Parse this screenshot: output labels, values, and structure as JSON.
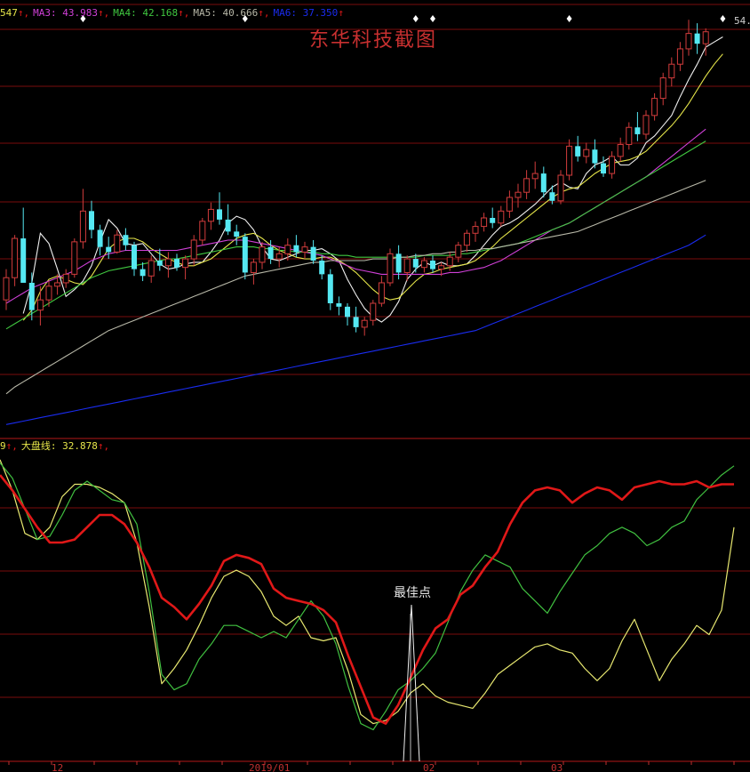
{
  "colors": {
    "background": "#000000",
    "grid": "#7a0c0c",
    "candle_up": "#d23c3c",
    "candle_down": "#55e8f2",
    "ma_white": "#f0f0f0",
    "ma_yellow": "#e6e64a",
    "ma_magenta": "#d040d8",
    "ma_green": "#40c840",
    "ma_gray": "#b8b8a8",
    "ma_blue": "#1a2cf0",
    "ind_red": "#e01818",
    "ind_green": "#40c040",
    "ind_yellow": "#e8e870",
    "marker": "#ffffff",
    "watermark": "#c83030"
  },
  "price_legend": [
    {
      "text": "547",
      "color": "#e6e64a"
    },
    {
      "text": "↑,",
      "color": "#e01818"
    },
    {
      "text": "MA3: 43.983",
      "color": "#d040d8"
    },
    {
      "text": "↑,",
      "color": "#e01818"
    },
    {
      "text": "MA4: 42.168",
      "color": "#40c840"
    },
    {
      "text": "↑,",
      "color": "#e01818"
    },
    {
      "text": "MA5: 40.666",
      "color": "#b8b8a8"
    },
    {
      "text": "↑,",
      "color": "#e01818"
    },
    {
      "text": "MA6: 37.350",
      "color": "#1a2cf0"
    },
    {
      "text": "↑",
      "color": "#e01818"
    }
  ],
  "indicator_legend": [
    {
      "text": "9",
      "color": "#e6e64a"
    },
    {
      "text": "↑,",
      "color": "#e01818"
    },
    {
      "text": "大盘线: 32.878",
      "color": "#e6e64a"
    },
    {
      "text": "↑,",
      "color": "#e01818"
    }
  ],
  "watermark": "东华科技截图",
  "annotation": "最佳点",
  "last_price_label": "54.",
  "x_labels": [
    "12",
    "2019/01",
    "02",
    "03"
  ],
  "chart_data": {
    "type": "candlestick",
    "price_ylim": [
      31.5,
      56.5
    ],
    "candles": [
      [
        39.2,
        41.0,
        38.6,
        40.5
      ],
      [
        40.5,
        43.0,
        40.0,
        42.8
      ],
      [
        42.8,
        44.6,
        42.3,
        40.2
      ],
      [
        40.2,
        40.8,
        38.0,
        38.6
      ],
      [
        38.6,
        40.0,
        37.7,
        39.2
      ],
      [
        39.2,
        40.3,
        38.8,
        40.0
      ],
      [
        40.0,
        40.7,
        39.5,
        40.2
      ],
      [
        40.2,
        41.0,
        39.9,
        40.7
      ],
      [
        40.7,
        42.8,
        40.5,
        42.6
      ],
      [
        42.6,
        45.7,
        42.2,
        44.4
      ],
      [
        44.4,
        45.0,
        42.8,
        43.3
      ],
      [
        43.3,
        43.6,
        41.8,
        42.3
      ],
      [
        42.3,
        42.9,
        41.6,
        42.0
      ],
      [
        42.0,
        43.3,
        41.9,
        43.0
      ],
      [
        43.0,
        43.4,
        42.1,
        42.4
      ],
      [
        42.4,
        42.6,
        40.6,
        41.0
      ],
      [
        41.0,
        41.4,
        40.3,
        40.6
      ],
      [
        40.6,
        41.8,
        40.2,
        41.5
      ],
      [
        41.5,
        42.2,
        40.9,
        41.2
      ],
      [
        41.2,
        42.0,
        40.5,
        41.6
      ],
      [
        41.6,
        41.9,
        40.9,
        41.1
      ],
      [
        41.1,
        41.8,
        40.4,
        41.6
      ],
      [
        41.6,
        43.0,
        41.2,
        42.7
      ],
      [
        42.7,
        44.0,
        42.4,
        43.8
      ],
      [
        43.8,
        44.9,
        43.3,
        44.5
      ],
      [
        44.5,
        45.5,
        43.6,
        43.9
      ],
      [
        43.9,
        44.8,
        43.0,
        43.2
      ],
      [
        43.2,
        43.6,
        42.4,
        42.9
      ],
      [
        42.9,
        43.1,
        40.4,
        40.8
      ],
      [
        40.8,
        41.6,
        40.1,
        41.4
      ],
      [
        41.4,
        42.6,
        41.0,
        42.3
      ],
      [
        42.3,
        42.7,
        41.3,
        41.6
      ],
      [
        41.6,
        42.3,
        41.1,
        41.9
      ],
      [
        41.9,
        42.8,
        41.5,
        42.4
      ],
      [
        42.4,
        43.0,
        41.7,
        42.0
      ],
      [
        42.0,
        42.6,
        41.6,
        42.3
      ],
      [
        42.3,
        42.7,
        41.3,
        41.5
      ],
      [
        41.5,
        41.8,
        40.4,
        40.7
      ],
      [
        40.7,
        41.0,
        38.6,
        39.0
      ],
      [
        39.0,
        39.4,
        38.3,
        38.8
      ],
      [
        38.8,
        39.0,
        37.7,
        38.2
      ],
      [
        38.2,
        38.8,
        37.3,
        37.6
      ],
      [
        37.6,
        38.2,
        37.1,
        38.0
      ],
      [
        38.0,
        39.2,
        37.7,
        39.0
      ],
      [
        39.0,
        40.6,
        38.8,
        40.2
      ],
      [
        40.2,
        42.2,
        40.0,
        41.9
      ],
      [
        41.9,
        42.4,
        40.4,
        40.8
      ],
      [
        40.8,
        41.8,
        40.3,
        41.6
      ],
      [
        41.6,
        41.9,
        40.8,
        41.1
      ],
      [
        41.1,
        41.7,
        40.8,
        41.5
      ],
      [
        41.5,
        41.8,
        40.8,
        41.0
      ],
      [
        41.0,
        41.4,
        40.6,
        41.2
      ],
      [
        41.2,
        42.0,
        40.9,
        41.7
      ],
      [
        41.7,
        42.6,
        41.4,
        42.4
      ],
      [
        42.4,
        43.3,
        42.0,
        43.1
      ],
      [
        43.1,
        43.8,
        42.6,
        43.5
      ],
      [
        43.5,
        44.3,
        43.2,
        44.0
      ],
      [
        44.0,
        44.6,
        43.4,
        43.7
      ],
      [
        43.7,
        44.7,
        43.5,
        44.4
      ],
      [
        44.4,
        45.6,
        44.0,
        45.2
      ],
      [
        45.2,
        46.0,
        44.6,
        45.5
      ],
      [
        45.5,
        46.8,
        45.1,
        46.3
      ],
      [
        46.3,
        47.3,
        45.7,
        46.6
      ],
      [
        46.6,
        47.0,
        45.2,
        45.5
      ],
      [
        45.5,
        45.9,
        44.8,
        45.0
      ],
      [
        45.0,
        46.8,
        44.8,
        46.5
      ],
      [
        46.5,
        48.6,
        46.2,
        48.2
      ],
      [
        48.2,
        48.8,
        47.3,
        47.6
      ],
      [
        47.6,
        48.4,
        47.2,
        48.0
      ],
      [
        48.0,
        48.6,
        46.9,
        47.2
      ],
      [
        47.2,
        47.6,
        46.4,
        46.6
      ],
      [
        46.6,
        47.9,
        46.3,
        47.6
      ],
      [
        47.6,
        48.7,
        47.3,
        48.3
      ],
      [
        48.3,
        49.6,
        48.0,
        49.3
      ],
      [
        49.3,
        50.2,
        48.5,
        48.9
      ],
      [
        48.9,
        50.3,
        48.6,
        50.0
      ],
      [
        50.0,
        51.3,
        49.7,
        51.0
      ],
      [
        51.0,
        52.5,
        50.6,
        52.2
      ],
      [
        52.2,
        53.4,
        51.7,
        53.0
      ],
      [
        53.0,
        54.3,
        52.6,
        53.9
      ],
      [
        53.9,
        55.6,
        53.5,
        54.8
      ],
      [
        54.8,
        55.4,
        53.6,
        54.2
      ],
      [
        54.2,
        55.1,
        53.5,
        54.9
      ]
    ],
    "ma_lines": [
      {
        "name": "MA1",
        "color": "#f0f0f0",
        "start": 2,
        "values": [
          38.4,
          40.2,
          43.1,
          42.5,
          41.0,
          39.4,
          39.8,
          40.3,
          41.2,
          42.6,
          43.9,
          43.4,
          42.5,
          42.4,
          42.5,
          41.9,
          41.3,
          41.0,
          41.1,
          41.3,
          41.4,
          41.4,
          42.0,
          42.7,
          43.7,
          44.1,
          43.9,
          43.3,
          42.3,
          41.6,
          41.5,
          41.7,
          41.9,
          42.1,
          42.1,
          42.2,
          41.9,
          41.5,
          40.4,
          39.5,
          38.7,
          38.2,
          37.9,
          38.3,
          39.1,
          40.4,
          41.0,
          41.4,
          41.2,
          41.4,
          41.2,
          41.2,
          41.3,
          41.8,
          42.4,
          43.0,
          43.5,
          43.7,
          44.0,
          44.4,
          44.8,
          45.3,
          45.8,
          46.1,
          45.8,
          45.7,
          46.6,
          47.1,
          47.3,
          47.6,
          47.1,
          47.1,
          47.5,
          48.4,
          48.8,
          49.4,
          50.0,
          51.1,
          52.1,
          53.0,
          54.0,
          54.3,
          54.6
        ]
      },
      {
        "name": "MA2",
        "color": "#e6e64a",
        "start": 2,
        "values": [
          38.0,
          38.6,
          39.7,
          40.4,
          40.6,
          40.4,
          40.2,
          40.1,
          40.6,
          41.4,
          42.2,
          42.6,
          42.8,
          42.8,
          42.6,
          42.2,
          41.9,
          41.6,
          41.4,
          41.2,
          41.2,
          41.4,
          41.6,
          42.0,
          42.4,
          42.8,
          43.0,
          43.1,
          42.8,
          42.4,
          42.1,
          41.9,
          41.7,
          41.6,
          41.6,
          41.7,
          41.7,
          41.5,
          41.2,
          40.8,
          40.3,
          39.8,
          39.4,
          39.2,
          39.3,
          39.8,
          40.3,
          40.7,
          40.8,
          41.0,
          41.1,
          41.2,
          41.3,
          41.5,
          41.9,
          42.3,
          42.8,
          43.2,
          43.6,
          44.0,
          44.4,
          44.8,
          45.2,
          45.5,
          45.7,
          45.8,
          46.2,
          46.6,
          46.9,
          47.2,
          47.3,
          47.4,
          47.6,
          47.9,
          48.4,
          48.9,
          49.4,
          50.0,
          50.7,
          51.5,
          52.3,
          53.0,
          53.6
        ]
      },
      {
        "name": "MA3",
        "color": "#d040d8",
        "start": 0,
        "values": [
          39.0,
          39.3,
          39.6,
          39.9,
          40.1,
          40.3,
          40.5,
          40.7,
          40.9,
          41.2,
          41.5,
          41.7,
          41.9,
          42.0,
          42.1,
          42.1,
          42.1,
          42.1,
          42.1,
          42.1,
          42.1,
          42.2,
          42.3,
          42.4,
          42.5,
          42.6,
          42.7,
          42.7,
          42.7,
          42.6,
          42.5,
          42.4,
          42.3,
          42.2,
          42.1,
          42.0,
          41.9,
          41.8,
          41.6,
          41.4,
          41.2,
          41.0,
          40.9,
          40.8,
          40.7,
          40.7,
          40.7,
          40.7,
          40.7,
          40.7,
          40.7,
          40.7,
          40.8,
          40.8,
          40.9,
          41.0,
          41.1,
          41.3,
          41.5,
          41.8,
          42.1,
          42.4,
          42.7,
          43.0,
          43.3,
          43.5,
          43.7,
          44.0,
          44.3,
          44.6,
          44.9,
          45.2,
          45.5,
          45.8,
          46.1,
          46.4,
          46.8,
          47.2,
          47.6,
          48.0,
          48.4,
          48.8,
          49.2
        ]
      },
      {
        "name": "MA4",
        "color": "#40c840",
        "start": 0,
        "values": [
          37.5,
          37.8,
          38.1,
          38.4,
          38.7,
          39.0,
          39.3,
          39.6,
          39.9,
          40.2,
          40.5,
          40.7,
          40.9,
          41.0,
          41.1,
          41.2,
          41.3,
          41.4,
          41.5,
          41.6,
          41.6,
          41.7,
          41.8,
          41.9,
          42.0,
          42.1,
          42.2,
          42.3,
          42.3,
          42.3,
          42.2,
          42.2,
          42.1,
          42.1,
          42.0,
          42.0,
          42.0,
          41.9,
          41.9,
          41.8,
          41.8,
          41.7,
          41.7,
          41.7,
          41.7,
          41.7,
          41.7,
          41.7,
          41.7,
          41.8,
          41.8,
          41.8,
          41.8,
          41.9,
          41.9,
          42.0,
          42.1,
          42.2,
          42.3,
          42.4,
          42.5,
          42.7,
          42.9,
          43.1,
          43.3,
          43.5,
          43.7,
          44.0,
          44.3,
          44.6,
          44.9,
          45.2,
          45.5,
          45.8,
          46.1,
          46.4,
          46.7,
          47.0,
          47.3,
          47.6,
          47.9,
          48.2,
          48.5
        ]
      },
      {
        "name": "MA5",
        "color": "#b8b8a8",
        "start": 0,
        "values": [
          33.7,
          34.1,
          34.4,
          34.7,
          35.0,
          35.3,
          35.6,
          35.9,
          36.2,
          36.5,
          36.8,
          37.1,
          37.4,
          37.6,
          37.8,
          38.0,
          38.2,
          38.4,
          38.6,
          38.8,
          39.0,
          39.2,
          39.4,
          39.6,
          39.8,
          40.0,
          40.2,
          40.4,
          40.6,
          40.7,
          40.8,
          40.9,
          41.0,
          41.1,
          41.2,
          41.3,
          41.4,
          41.4,
          41.5,
          41.5,
          41.5,
          41.5,
          41.5,
          41.6,
          41.6,
          41.6,
          41.7,
          41.7,
          41.8,
          41.8,
          41.9,
          41.9,
          42.0,
          42.0,
          42.1,
          42.1,
          42.2,
          42.2,
          42.3,
          42.4,
          42.5,
          42.6,
          42.7,
          42.8,
          42.9,
          43.0,
          43.1,
          43.2,
          43.4,
          43.6,
          43.8,
          44.0,
          44.2,
          44.4,
          44.6,
          44.8,
          45.0,
          45.2,
          45.4,
          45.6,
          45.8,
          46.0,
          46.2
        ]
      },
      {
        "name": "MA6",
        "color": "#1a2cf0",
        "start": 0,
        "values": [
          31.9,
          32.0,
          32.1,
          32.2,
          32.3,
          32.4,
          32.5,
          32.6,
          32.7,
          32.8,
          32.9,
          33.0,
          33.1,
          33.2,
          33.3,
          33.4,
          33.5,
          33.6,
          33.7,
          33.8,
          33.9,
          34.0,
          34.1,
          34.2,
          34.3,
          34.4,
          34.5,
          34.6,
          34.7,
          34.8,
          34.9,
          35.0,
          35.1,
          35.2,
          35.3,
          35.4,
          35.5,
          35.6,
          35.7,
          35.8,
          35.9,
          36.0,
          36.1,
          36.2,
          36.3,
          36.4,
          36.5,
          36.6,
          36.7,
          36.8,
          36.9,
          37.0,
          37.1,
          37.2,
          37.3,
          37.4,
          37.6,
          37.8,
          38.0,
          38.2,
          38.4,
          38.6,
          38.8,
          39.0,
          39.2,
          39.4,
          39.6,
          39.8,
          40.0,
          40.2,
          40.4,
          40.6,
          40.8,
          41.0,
          41.2,
          41.4,
          41.6,
          41.8,
          42.0,
          42.2,
          42.4,
          42.7,
          43.0
        ]
      }
    ],
    "markers": [
      9,
      28,
      48,
      50,
      66,
      84
    ],
    "indicator": {
      "ylim": [
        0,
        100
      ],
      "series": [
        {
          "name": "red",
          "color": "#e01818",
          "width": 2.6,
          "values": [
            93,
            88,
            82,
            76,
            71,
            71,
            72,
            76,
            80,
            80,
            77,
            71,
            63,
            53,
            50,
            46,
            51,
            57,
            65,
            67,
            66,
            64,
            56,
            53,
            52,
            51,
            49,
            45,
            34,
            24,
            14,
            12,
            18,
            27,
            36,
            43,
            46,
            54,
            57,
            63,
            68,
            77,
            84,
            88,
            89,
            88,
            84,
            87,
            89,
            88,
            85,
            89,
            90,
            91,
            90,
            90,
            91,
            89,
            90,
            90
          ]
        },
        {
          "name": "green",
          "color": "#40c040",
          "width": 1.2,
          "values": [
            97,
            92,
            82,
            72,
            73,
            80,
            88,
            91,
            88,
            85,
            84,
            77,
            55,
            28,
            23,
            25,
            33,
            38,
            44,
            44,
            42,
            40,
            42,
            40,
            46,
            52,
            47,
            38,
            24,
            12,
            10,
            16,
            23,
            26,
            30,
            35,
            45,
            55,
            62,
            67,
            65,
            63,
            56,
            52,
            48,
            55,
            61,
            67,
            70,
            74,
            76,
            74,
            70,
            72,
            76,
            78,
            85,
            89,
            93,
            96
          ]
        },
        {
          "name": "yellow",
          "color": "#e8e870",
          "width": 1.2,
          "values": [
            98,
            88,
            74,
            72,
            76,
            86,
            90,
            90,
            89,
            87,
            84,
            71,
            50,
            25,
            30,
            36,
            44,
            53,
            60,
            62,
            60,
            55,
            47,
            44,
            47,
            40,
            39,
            40,
            29,
            15,
            12,
            13,
            16,
            22,
            25,
            21,
            19,
            18,
            17,
            22,
            28,
            31,
            34,
            37,
            38,
            36,
            35,
            30,
            26,
            30,
            39,
            46,
            36,
            26,
            33,
            38,
            44,
            41,
            49,
            76
          ]
        }
      ]
    },
    "best_point": {
      "x_index": 30,
      "label": "最佳点"
    }
  }
}
